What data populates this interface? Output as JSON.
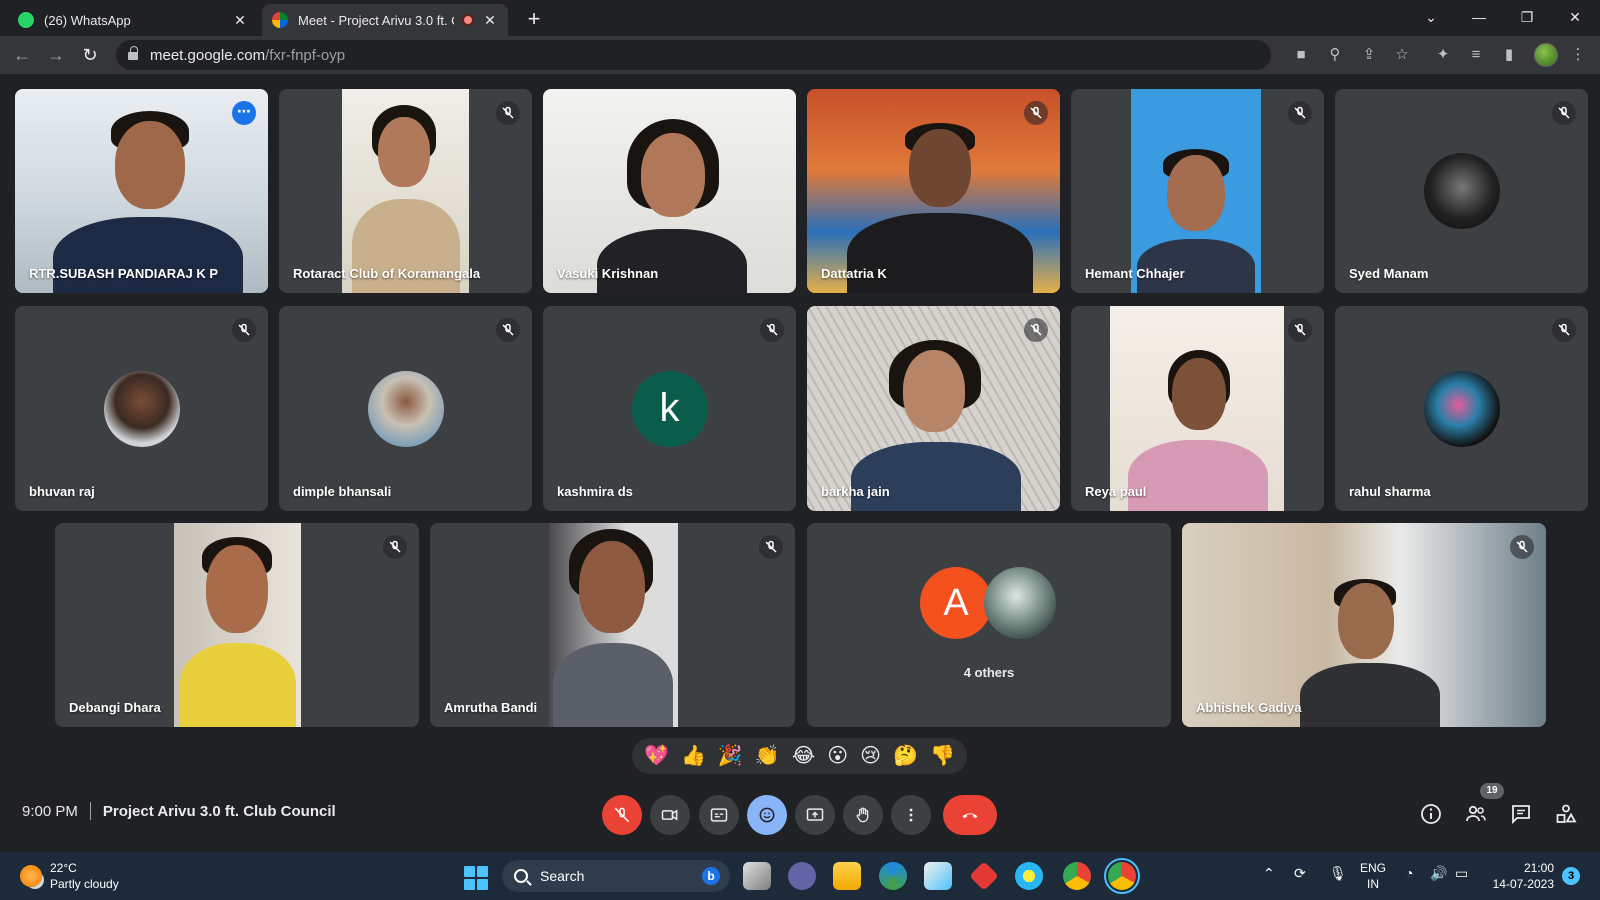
{
  "browser": {
    "tabs": [
      {
        "title": "(26) WhatsApp",
        "active": false
      },
      {
        "title": "Meet - Project Arivu 3.0 ft. Cl",
        "active": true
      }
    ],
    "url_host": "meet.google.com",
    "url_path": "/fxr-fnpf-oyp"
  },
  "participants": [
    {
      "name": "RTR.SUBASH PANDIARAJ K P",
      "type": "video",
      "muted": false,
      "speaking": true
    },
    {
      "name": "Rotaract Club of Koramangala",
      "type": "video",
      "muted": true
    },
    {
      "name": "Vasuki Krishnan",
      "type": "video",
      "muted": false
    },
    {
      "name": "Dattatria K",
      "type": "video",
      "muted": true
    },
    {
      "name": "Hemant Chhajer",
      "type": "video",
      "muted": true
    },
    {
      "name": "Syed Manam",
      "type": "avatar",
      "muted": true
    },
    {
      "name": "bhuvan raj",
      "type": "avatar",
      "muted": true
    },
    {
      "name": "dimple bhansali",
      "type": "avatar",
      "muted": true
    },
    {
      "name": "kashmira ds",
      "type": "letter",
      "letter": "k",
      "muted": true
    },
    {
      "name": "barkha jain",
      "type": "video",
      "muted": true
    },
    {
      "name": "Reya paul",
      "type": "video",
      "muted": true
    },
    {
      "name": "rahul sharma",
      "type": "avatar",
      "muted": true
    },
    {
      "name": "Debangi Dhara",
      "type": "video",
      "muted": true
    },
    {
      "name": "Amrutha Bandi",
      "type": "video",
      "muted": true
    },
    {
      "name": "Abhishek Gadiya",
      "type": "video",
      "muted": true
    }
  ],
  "others_tile": {
    "letter": "A",
    "label": "4 others"
  },
  "reactions": [
    "💖",
    "👍",
    "🎉",
    "👏",
    "😂",
    "😮",
    "😢",
    "🤔",
    "👎"
  ],
  "meeting": {
    "time": "9:00 PM",
    "title": "Project Arivu 3.0 ft. Club Council",
    "people_count": "19"
  },
  "colors": {
    "background": "#202124",
    "tile": "#3c4043",
    "accent": "#8ab4f8",
    "danger": "#ea4335"
  },
  "taskbar": {
    "temperature": "22°C",
    "weather": "Partly cloudy",
    "search_placeholder": "Search",
    "lang_top": "ENG",
    "lang_bottom": "IN",
    "time": "21:00",
    "date": "14-07-2023",
    "notifications": "3"
  }
}
